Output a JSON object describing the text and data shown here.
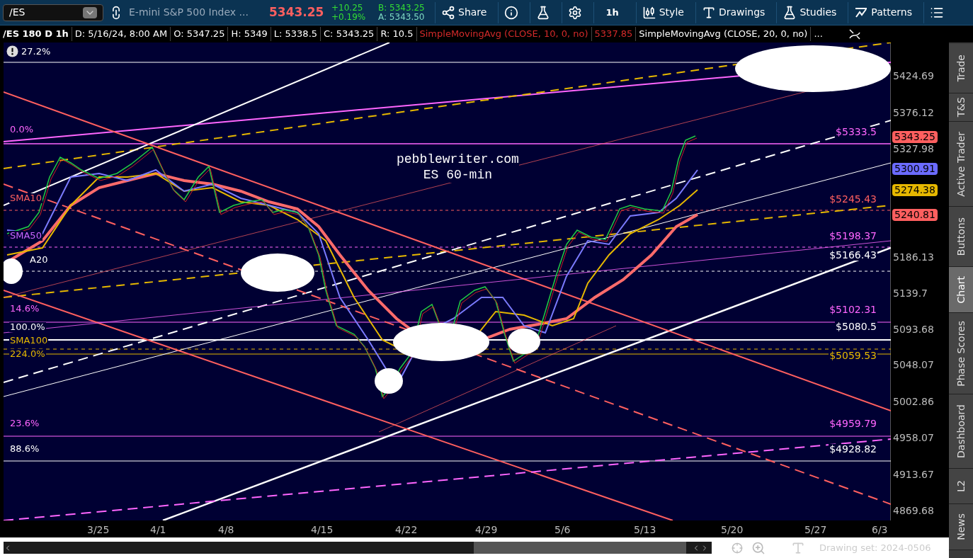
{
  "toolbar": {
    "symbol": "/ES",
    "description": "E-mini S&P 500 Index ...",
    "last": "5343.25",
    "change": "+10.25",
    "change_pct": "+0.19%",
    "bid": "B: 5343.25",
    "ask": "A: 5343.50",
    "buttons": [
      {
        "kind": "share",
        "label": "Share"
      },
      {
        "kind": "info"
      },
      {
        "kind": "flask"
      },
      {
        "kind": "gear"
      },
      {
        "kind": "plain",
        "label": "1h"
      },
      {
        "kind": "style",
        "label": "Style"
      },
      {
        "kind": "drawings",
        "label": "Drawings"
      },
      {
        "kind": "studies",
        "label": "Studies"
      },
      {
        "kind": "patterns",
        "label": "Patterns"
      },
      {
        "kind": "menu"
      }
    ]
  },
  "header": {
    "title": "/ES 180 D 1h",
    "fields": [
      "D: 5/16/24, 8:00 AM",
      "O: 5347.25",
      "H: 5349",
      "L: 5338.5",
      "C: 5343.25",
      "R: 10.5"
    ],
    "studies": [
      {
        "label": "SimpleMovingAvg (CLOSE, 10, 0, no)",
        "value": "5337.85",
        "color": "#d42a2a"
      },
      {
        "label": "SimpleMovingAvg (CLOSE, 20, 0, no)",
        "color": "#ffffff"
      }
    ],
    "more": "..."
  },
  "chart": {
    "watermark": [
      "pebblewriter.com",
      "ES 60-min"
    ],
    "left_labels": [
      {
        "text": "27.2%",
        "color": "#ffffff"
      },
      {
        "text": "0.0%",
        "color": "#ff66ff"
      },
      {
        "text": "SMA10",
        "color": "#ff5f5f"
      },
      {
        "text": "SMA50",
        "color": "#cc66ff"
      },
      {
        "text": "A20",
        "color": "#ffffff"
      },
      {
        "text": "14.6%",
        "color": "#ff66ff"
      },
      {
        "text": "100.0%",
        "color": "#ffffff"
      },
      {
        "text": "SMA100",
        "color": "#e6b800"
      },
      {
        "text": "224.0%",
        "color": "#e6b800"
      },
      {
        "text": "23.6%",
        "color": "#ff66ff"
      },
      {
        "text": "88.6%",
        "color": "#ffffff"
      }
    ],
    "right_labels": [
      {
        "text": "$5333.5",
        "color": "#ff66ff"
      },
      {
        "text": "$5245.43",
        "color": "#ff5f5f"
      },
      {
        "text": "$5198.37",
        "color": "#ff66ff"
      },
      {
        "text": "$5166.43",
        "color": "#ffffff"
      },
      {
        "text": "$5102.31",
        "color": "#ff66ff"
      },
      {
        "text": "$5080.5",
        "color": "#ffffff"
      },
      {
        "text": "$5059.53",
        "color": "#e6b800"
      },
      {
        "text": "$4959.79",
        "color": "#ff66ff"
      },
      {
        "text": "$4928.82",
        "color": "#ffffff"
      }
    ],
    "price_axis": [
      "5424.69",
      "5376.12",
      "5327.98",
      "5186.13",
      "5139.7",
      "5093.68",
      "5048.07",
      "5002.86",
      "4958.07",
      "4913.67",
      "4869.68"
    ],
    "badges": [
      {
        "text": "5343.25",
        "color": "#ff5f5f"
      },
      {
        "text": "5300.91",
        "color": "#6b6bff"
      },
      {
        "text": "5274.38",
        "color": "#e6b800"
      },
      {
        "text": "5240.81",
        "color": "#ff5f5f"
      }
    ],
    "time_axis": [
      "3/25",
      "4/1",
      "4/8",
      "4/15",
      "4/22",
      "4/29",
      "5/6",
      "5/13",
      "5/20",
      "5/27",
      "6/3"
    ]
  },
  "status": {
    "drawing_set": "Drawing set: 2024-0506"
  },
  "side_tabs": [
    {
      "label": "Trade",
      "selected": false
    },
    {
      "label": "T&S",
      "selected": false
    },
    {
      "label": "Active Trader",
      "selected": false
    },
    {
      "label": "Buttons",
      "selected": false
    },
    {
      "label": "Chart",
      "selected": true
    },
    {
      "label": "Phase Scores",
      "selected": false
    },
    {
      "label": "Dashboard",
      "selected": false
    },
    {
      "label": "L2",
      "selected": false
    },
    {
      "label": "News",
      "selected": false
    }
  ]
}
